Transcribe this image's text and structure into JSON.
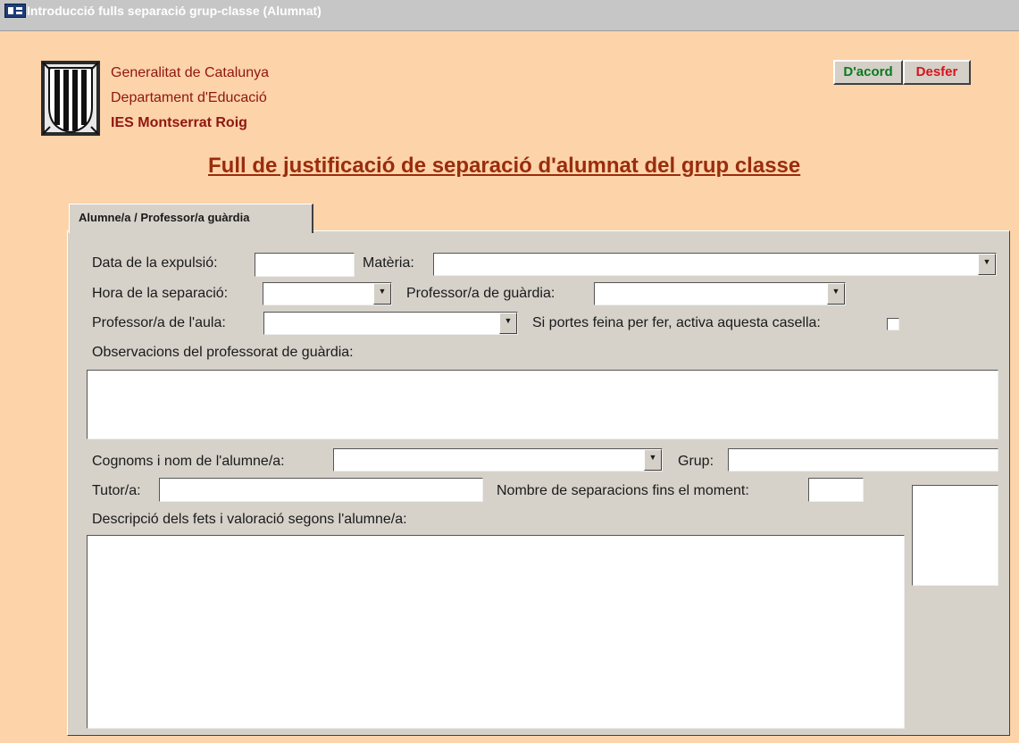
{
  "window": {
    "title": "Introducció fulls separació grup-classe (Alumnat)"
  },
  "org": {
    "line1": "Generalitat de Catalunya",
    "line2": "Departament d'Educació",
    "line3": "IES Montserrat Roig"
  },
  "buttons": {
    "ok": "D'acord",
    "undo": "Desfer"
  },
  "heading": "Full de justificació de separació d'alumnat del grup classe",
  "tab": "Alumne/a / Professor/a guàrdia",
  "form": {
    "date_label": "Data de la expulsió:",
    "subject_label": "Matèria:",
    "hour_label": "Hora de la separació:",
    "guard_label": "Professor/a de guàrdia:",
    "teacher_label": "Professor/a de l'aula:",
    "work_label": "Si portes feina per fer, activa aquesta casella:",
    "obs_label": "Observacions del professorat de guàrdia:",
    "student_label": "Cognoms i nom de l'alumne/a:",
    "group_label": "Grup:",
    "tutor_label": "Tutor/a:",
    "count_label": "Nombre de separacions fins el moment:",
    "desc_label": "Descripció dels fets i valoració segons l'alumne/a:"
  },
  "colors": {
    "background": "#fdd3aa",
    "panel": "#d6d2ca",
    "org_text": "#8f1610",
    "heading": "#9a2c0c",
    "ok": "#0b7a1e",
    "undo": "#d8131a"
  }
}
